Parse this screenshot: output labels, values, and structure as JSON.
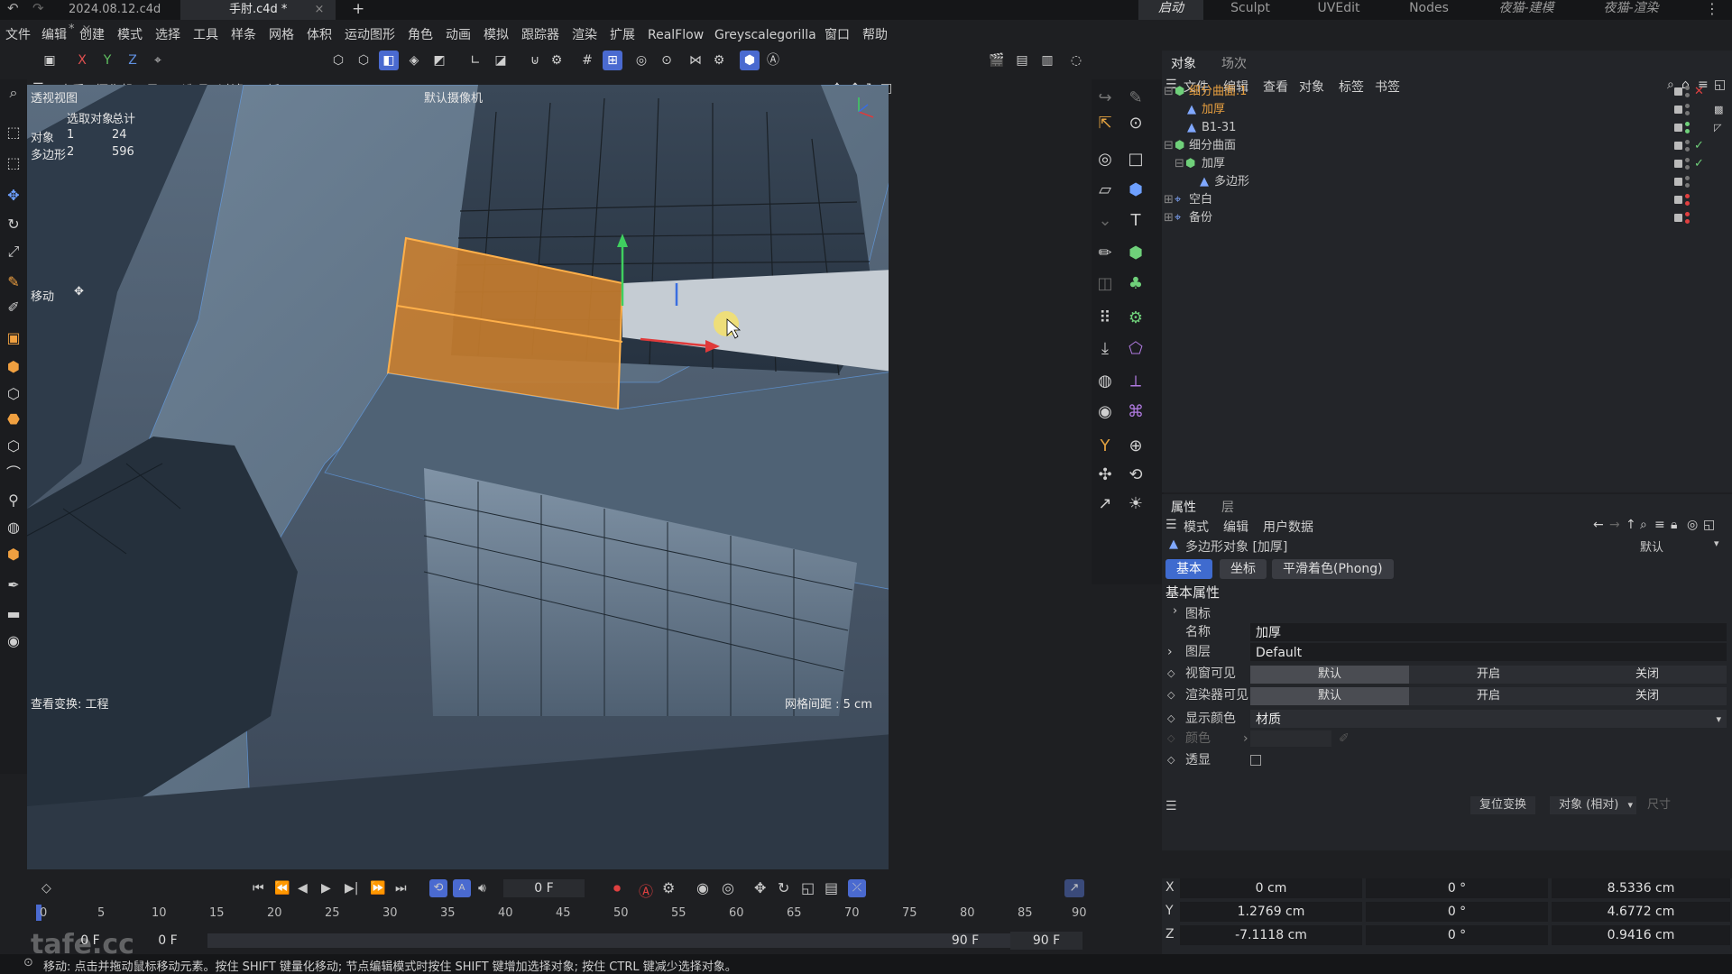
{
  "titlebar": {
    "tabs": [
      {
        "label": "2024.08.12.c4d *",
        "active": false
      },
      {
        "label": "手肘.c4d *",
        "active": true
      }
    ],
    "add_tab": "+",
    "workspaces": [
      "启动",
      "Sculpt",
      "UVEdit",
      "Nodes",
      "夜猫-建模",
      "夜猫-渲染"
    ],
    "active_workspace": "启动"
  },
  "menubar": {
    "items": [
      "文件",
      "编辑",
      "创建",
      "模式",
      "选择",
      "工具",
      "样条",
      "网格",
      "体积",
      "运动图形",
      "角色",
      "动画",
      "模拟",
      "跟踪器",
      "渲染",
      "扩展",
      "RealFlow",
      "Greyscalegorilla",
      "窗口",
      "帮助"
    ]
  },
  "toolbar": {
    "axis_x": "X",
    "axis_y": "Y",
    "axis_z": "Z"
  },
  "viewport": {
    "menu": [
      "查看",
      "摄像机",
      "显示",
      "选项",
      "过滤",
      "面板"
    ],
    "view_name": "透视视图",
    "camera": "默认摄像机",
    "stats": {
      "header_selected": "选取对象",
      "header_total": "总计",
      "rows": [
        {
          "label": "对象",
          "selected": "1",
          "total": "24"
        },
        {
          "label": "多边形",
          "selected": "2",
          "total": "596"
        }
      ]
    },
    "tool_label": "移动",
    "view_transform": "查看变换: 工程",
    "grid_spacing": "网格间距 : 5 cm"
  },
  "object_manager": {
    "tabs": [
      "对象",
      "场次"
    ],
    "menu": [
      "文件",
      "编辑",
      "查看",
      "对象",
      "标签",
      "书签"
    ],
    "objects": [
      {
        "name": "细分曲面.1",
        "indent": 0,
        "highlight": true,
        "status": "off"
      },
      {
        "name": "加厚",
        "indent": 1,
        "highlight": true,
        "status": "none"
      },
      {
        "name": "B1-31",
        "indent": 1,
        "highlight": false,
        "status": "none"
      },
      {
        "name": "细分曲面",
        "indent": 0,
        "highlight": false,
        "status": "on"
      },
      {
        "name": "加厚",
        "indent": 1,
        "highlight": false,
        "status": "on"
      },
      {
        "name": "多边形",
        "indent": 2,
        "highlight": false,
        "status": "none"
      },
      {
        "name": "空白",
        "indent": 0,
        "highlight": false,
        "status": "none"
      },
      {
        "name": "备份",
        "indent": 0,
        "highlight": false,
        "status": "none"
      }
    ]
  },
  "attributes": {
    "tabs": [
      "属性",
      "层"
    ],
    "menu": [
      "模式",
      "编辑",
      "用户数据"
    ],
    "object_title": "多边形对象 [加厚]",
    "preset": "默认",
    "subtabs": [
      "基本",
      "坐标",
      "平滑着色(Phong)"
    ],
    "section": "基本属性",
    "icon_group": "图标",
    "name_label": "名称",
    "name_value": "加厚",
    "layer_label": "图层",
    "layer_value": "Default",
    "viewport_visible_label": "视窗可见",
    "render_visible_label": "渲染器可见",
    "visibility_options": [
      "默认",
      "开启",
      "关闭"
    ],
    "display_color_label": "显示颜色",
    "display_color_value": "材质",
    "color_label": "颜色",
    "xray_label": "透显"
  },
  "coordinates": {
    "reset_button": "复位变换",
    "mode": "对象 (相对)",
    "size_label": "尺寸",
    "rows": [
      {
        "axis": "X",
        "pos": "0 cm",
        "rot": "0 °",
        "size": "8.5336 cm"
      },
      {
        "axis": "Y",
        "pos": "1.2769 cm",
        "rot": "0 °",
        "size": "4.6772 cm"
      },
      {
        "axis": "Z",
        "pos": "-7.1118 cm",
        "rot": "0 °",
        "size": "0.9416 cm"
      }
    ]
  },
  "timeline": {
    "current_frame": "0 F",
    "ticks": [
      "0",
      "5",
      "10",
      "15",
      "20",
      "25",
      "30",
      "35",
      "40",
      "45",
      "50",
      "55",
      "60",
      "65",
      "70",
      "75",
      "80",
      "85",
      "90"
    ],
    "start_a": "0 F",
    "start_b": "0 F",
    "end_a": "90 F",
    "end_b": "90 F"
  },
  "statusbar": {
    "text": "移动: 点击并拖动鼠标移动元素。按住 SHIFT 键量化移动; 节点编辑模式时按住 SHIFT 键增加选择对象; 按住 CTRL 键减少选择对象。"
  },
  "watermark": "tafe.cc",
  "colors": {
    "accent": "#4a6ad0",
    "selection_orange": "#c87d2e",
    "object_highlight": "#e8a040"
  }
}
